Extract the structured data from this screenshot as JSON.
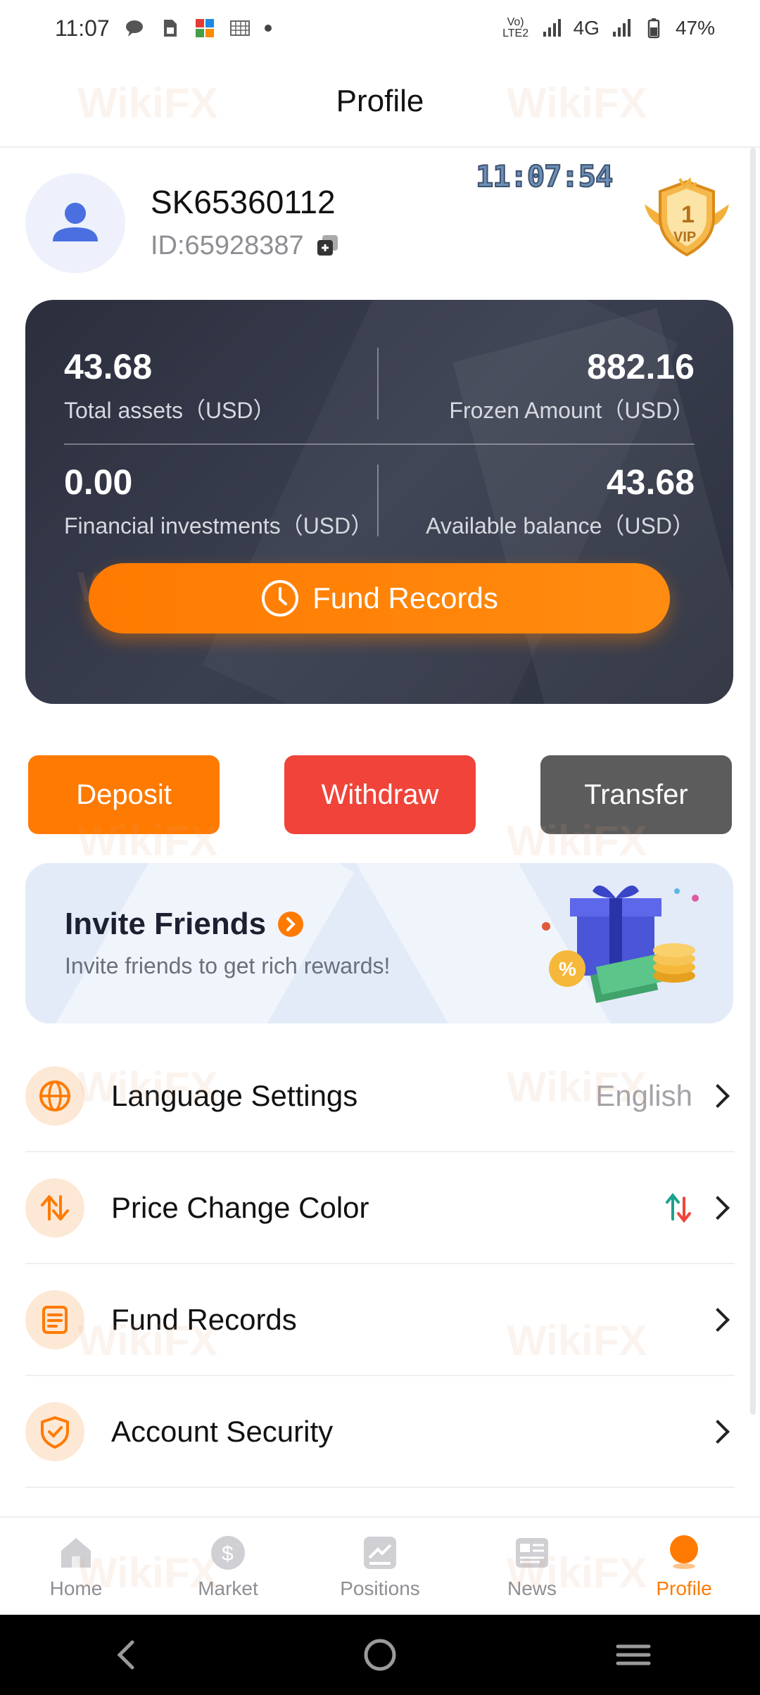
{
  "status_bar": {
    "time": "11:07",
    "network": "4G",
    "lte": "Vo) LTE2",
    "battery": "47%"
  },
  "header": {
    "title": "Profile"
  },
  "profile": {
    "username": "SK65360112",
    "user_id": "ID:65928387",
    "clock_overlay": "11:07:54",
    "vip_level": "1",
    "vip_text": "VIP"
  },
  "assets": {
    "total_assets": {
      "value": "43.68",
      "label": "Total assets（USD）"
    },
    "frozen_amount": {
      "value": "882.16",
      "label": "Frozen Amount（USD）"
    },
    "financial_investments": {
      "value": "0.00",
      "label": "Financial investments（USD）"
    },
    "available_balance": {
      "value": "43.68",
      "label": "Available balance（USD）"
    },
    "fund_records_label": "Fund Records"
  },
  "actions": {
    "deposit": "Deposit",
    "withdraw": "Withdraw",
    "transfer": "Transfer"
  },
  "invite": {
    "title": "Invite Friends",
    "subtitle": "Invite friends to get rich rewards!"
  },
  "menu": {
    "items": [
      {
        "label": "Language Settings",
        "value": "English",
        "icon": "globe-icon"
      },
      {
        "label": "Price Change Color",
        "value": "",
        "icon": "price-change-icon"
      },
      {
        "label": "Fund Records",
        "value": "",
        "icon": "document-icon"
      },
      {
        "label": "Account Security",
        "value": "",
        "icon": "shield-icon"
      }
    ]
  },
  "bottom_nav": {
    "items": [
      {
        "label": "Home",
        "icon": "home-icon",
        "active": false
      },
      {
        "label": "Market",
        "icon": "market-icon",
        "active": false
      },
      {
        "label": "Positions",
        "icon": "positions-icon",
        "active": false
      },
      {
        "label": "News",
        "icon": "news-icon",
        "active": false
      },
      {
        "label": "Profile",
        "icon": "profile-icon",
        "active": true
      }
    ]
  },
  "watermark": "WikiFX",
  "colors": {
    "accent": "#ff7a00",
    "withdraw": "#f0443a",
    "transfer": "#5c5c5c",
    "card_dark": "#2b2e3c",
    "up": "#1aa38a",
    "down": "#f0443a"
  }
}
